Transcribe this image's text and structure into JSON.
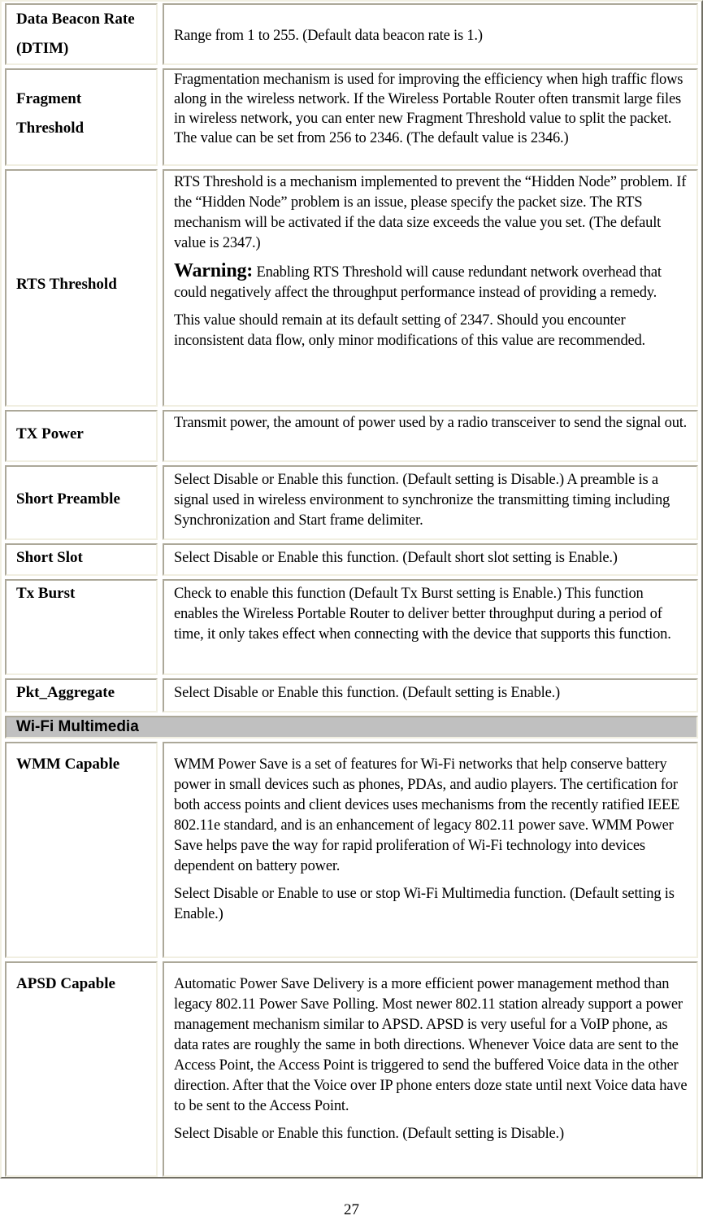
{
  "rows": [
    {
      "label_lines": [
        "Data Beacon Rate",
        "(DTIM)"
      ],
      "paragraphs": [
        "Range from 1 to 255. (Default data beacon rate is 1.)"
      ]
    },
    {
      "label_lines": [
        "Fragment",
        "Threshold"
      ],
      "paragraphs": [
        "Fragmentation mechanism is used for improving the efficiency when high traffic flows along in the wireless network. If the Wireless Portable Router often transmit large files in wireless network, you can enter new Fragment Threshold value to split the packet. The value can be set from 256 to 2346. (The default value is 2346.)"
      ]
    },
    {
      "label_lines": [
        "RTS Threshold"
      ],
      "paragraphs": [
        "RTS Threshold is a mechanism implemented to prevent the “Hidden Node” problem. If the “Hidden Node” problem is an issue, please specify the packet size. The RTS mechanism will be activated if the data size exceeds the value you set. (The default value is 2347.)",
        "This value should remain at its default setting of 2347. Should you encounter inconsistent data flow, only minor modifications of this value are recommended."
      ],
      "warning_label": "Warning:",
      "warning_text": " Enabling RTS Threshold will cause redundant network overhead that could negatively affect the throughput performance instead of providing a remedy."
    },
    {
      "label_lines": [
        "TX Power"
      ],
      "paragraphs": [
        "Transmit power, the amount of power used by a radio transceiver to send the signal out."
      ]
    },
    {
      "label_lines": [
        "Short Preamble"
      ],
      "paragraphs": [
        "Select Disable or Enable this function. (Default setting is Disable.) A preamble is a signal used in wireless environment to synchronize the transmitting timing including Synchronization and Start frame delimiter."
      ]
    },
    {
      "label_lines": [
        "Short Slot"
      ],
      "paragraphs": [
        "Select Disable or Enable this function. (Default short slot setting is Enable.)"
      ]
    },
    {
      "label_lines": [
        "Tx Burst"
      ],
      "paragraphs": [
        "Check to enable this function (Default Tx Burst setting is Enable.) This function enables the Wireless Portable Router to deliver better throughput during a period of time, it only takes effect when connecting with the device that supports this function."
      ]
    },
    {
      "label_lines": [
        "Pkt_Aggregate"
      ],
      "paragraphs": [
        "Select Disable or Enable this function. (Default setting is Enable.)"
      ]
    },
    {
      "label_lines": [
        "WMM Capable"
      ],
      "paragraphs": [
        "WMM Power Save is a set of features for Wi-Fi networks that help conserve battery power in small devices such as phones, PDAs, and audio players. The certification for both access points and client devices uses mechanisms from the recently ratified IEEE 802.11e standard, and is an enhancement of legacy 802.11 power save. WMM Power Save helps pave the way for rapid proliferation of Wi-Fi technology into devices dependent on battery power.",
        "Select Disable or Enable to use or stop Wi-Fi Multimedia function. (Default setting is Enable.)"
      ]
    },
    {
      "label_lines": [
        "APSD Capable"
      ],
      "paragraphs": [
        "Automatic Power Save Delivery is a more efficient power management method than legacy 802.11 Power Save Polling. Most newer 802.11 station already support a power management mechanism similar to APSD. APSD is very useful for a VoIP phone, as data rates are roughly the same in both directions. Whenever Voice data are sent to the Access Point, the Access Point is triggered to send the buffered Voice data in the other direction. After that the Voice over IP phone enters doze state until next Voice data have to be sent to the Access Point.",
        "Select Disable or Enable this function. (Default setting is Disable.)"
      ]
    }
  ],
  "section_header": "Wi-Fi Multimedia",
  "page_number": "27"
}
